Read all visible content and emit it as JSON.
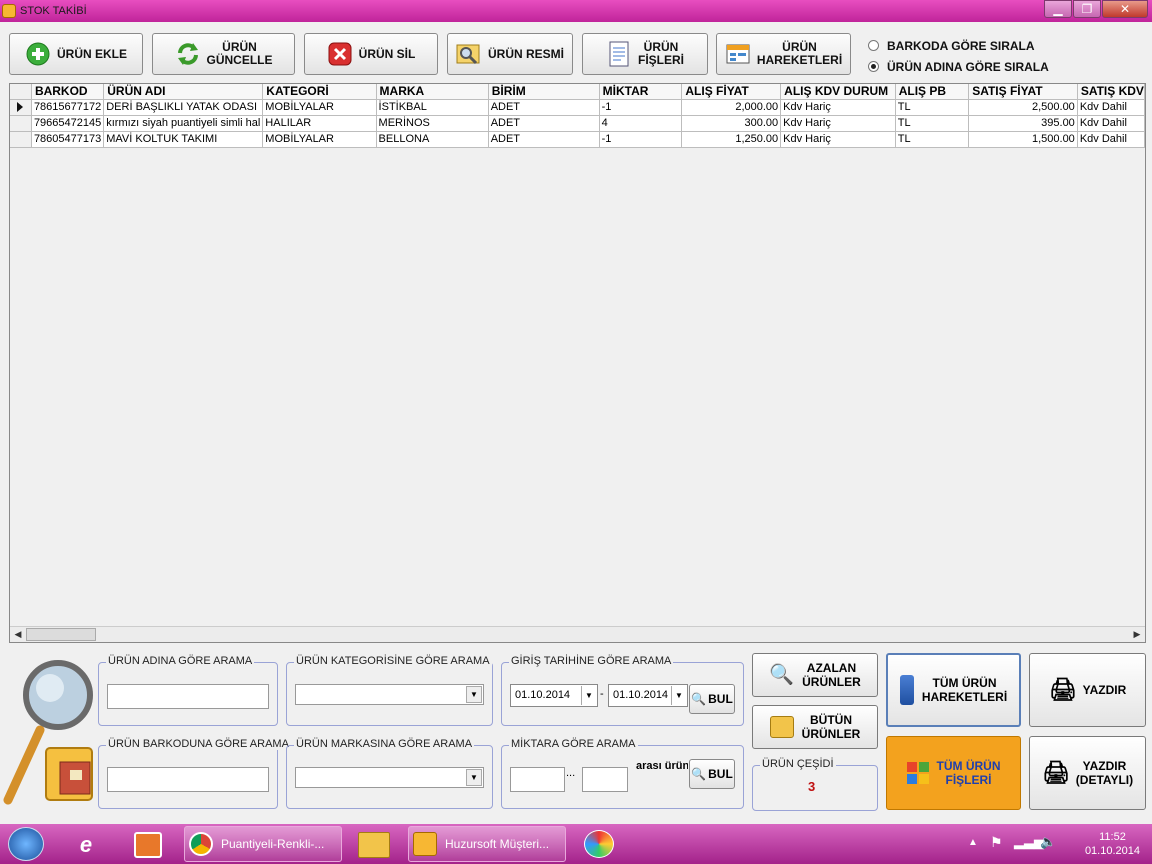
{
  "window": {
    "title": "STOK TAKİBİ",
    "min_icon": "▁",
    "max_icon": "❐",
    "close_icon": "✕"
  },
  "toolbar": {
    "add_label": "ÜRÜN EKLE",
    "update_label_1": "ÜRÜN",
    "update_label_2": "GÜNCELLE",
    "delete_label": "ÜRÜN SİL",
    "image_label": "ÜRÜN RESMİ",
    "slips_label_1": "ÜRÜN",
    "slips_label_2": "FİŞLERİ",
    "movements_label_1": "ÜRÜN",
    "movements_label_2": "HAREKETLERİ"
  },
  "sort": {
    "by_barcode": "BARKODA GÖRE SIRALA",
    "by_name": "ÜRÜN ADINA GÖRE SIRALA",
    "selected": "by_name"
  },
  "grid": {
    "columns": [
      "BARKOD",
      "ÜRÜN ADI",
      "KATEGORİ",
      "MARKA",
      "BİRİM",
      "MİKTAR",
      "ALIŞ FİYAT",
      "ALIŞ KDV DURUM",
      "ALIŞ PB",
      "SATIŞ FİYAT",
      "SATIŞ KDV"
    ],
    "rows": [
      [
        "78615677172",
        "DERİ BAŞLIKLI YATAK ODASI",
        "MOBİLYALAR",
        "İSTİKBAL",
        "ADET",
        "-1",
        "2,000.00",
        "Kdv Hariç",
        "TL",
        "2,500.00",
        "Kdv Dahil"
      ],
      [
        "79665472145",
        "kırmızı siyah puantiyeli simli hal",
        "HALILAR",
        "MERİNOS",
        "ADET",
        "4",
        "300.00",
        "Kdv Hariç",
        "TL",
        "395.00",
        "Kdv Dahil"
      ],
      [
        "78605477173",
        "MAVİ KOLTUK TAKIMI",
        "MOBİLYALAR",
        "BELLONA",
        "ADET",
        "-1",
        "1,250.00",
        "Kdv Hariç",
        "TL",
        "1,500.00",
        "Kdv Dahil"
      ]
    ]
  },
  "search": {
    "by_name": "ÜRÜN ADINA GÖRE ARAMA",
    "by_category": "ÜRÜN KATEGORİSİNE GÖRE ARAMA",
    "by_date": "GİRİŞ TARİHİNE GÖRE ARAMA",
    "by_barcode": "ÜRÜN BARKODUNA GÖRE ARAMA",
    "by_brand": "ÜRÜN MARKASINA GÖRE ARAMA",
    "by_quantity": "MİKTARA GÖRE ARAMA",
    "date_from": "01.10.2014",
    "date_to": "01.10.2014",
    "date_sep": "-",
    "qty_sep": "...",
    "between_label": "arası ürün",
    "find_label": "BUL"
  },
  "actions": {
    "decreasing_1": "AZALAN",
    "decreasing_2": "ÜRÜNLER",
    "all_1": "BÜTÜN",
    "all_2": "ÜRÜNLER",
    "variety_label": "ÜRÜN ÇEŞİDİ",
    "variety_count": "3",
    "all_movements_1": "TÜM ÜRÜN",
    "all_movements_2": "HAREKETLERİ",
    "all_slips_1": "TÜM ÜRÜN",
    "all_slips_2": "FİŞLERİ",
    "print": "YAZDIR",
    "print_detail_1": "YAZDIR",
    "print_detail_2": "(DETAYLI)"
  },
  "taskbar": {
    "task1": "Puantiyeli-Renkli-...",
    "task2": "Huzursoft Müşteri...",
    "time": "11:52",
    "date": "01.10.2014"
  }
}
